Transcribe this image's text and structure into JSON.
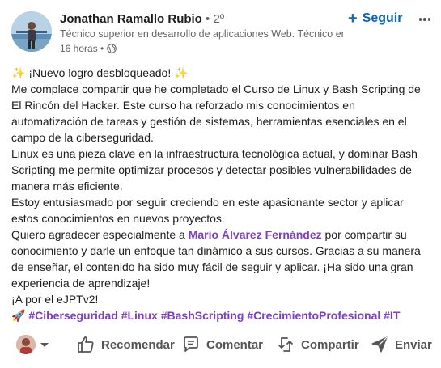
{
  "author": {
    "name": "Jonathan Ramallo Rubio",
    "degree": "• 2º",
    "headline": "Técnico superior en desarrollo de aplicaciones Web. Técnico en s...",
    "time": "16 horas •",
    "follow_label": "Seguir"
  },
  "post": {
    "line1_emoji_left": "✨",
    "line1_text": " ¡Nuevo logro desbloqueado! ",
    "line1_emoji_right": "✨",
    "para1": "Me complace compartir que he completado el Curso de Linux y Bash Scripting de El Rincón del Hacker. Este curso ha reforzado mis conocimientos en automatización de tareas y gestión de sistemas, herramientas esenciales en el campo de la ciberseguridad.",
    "para2": "Linux es una pieza clave en la infraestructura tecnológica actual, y dominar Bash Scripting me permite optimizar procesos y detectar posibles vulnerabilidades de manera más eficiente.",
    "para3": "Estoy entusiasmado por seguir creciendo en este apasionante sector y aplicar estos conocimientos en nuevos proyectos.",
    "para4_before": "Quiero agradecer especialmente a ",
    "para4_mention": "Mario Álvarez Fernández",
    "para4_after": " por compartir su conocimiento y darle un enfoque tan dinámico a sus cursos. Gracias a su manera de enseñar, el contenido ha sido muy fácil de seguir y aplicar. ¡Ha sido una gran experiencia de aprendizaje!",
    "para5": "¡A por el eJPTv2!",
    "rocket_emoji": "🚀",
    "hashtags": [
      "#Ciberseguridad",
      "#Linux",
      "#BashScripting",
      "#CrecimientoProfesional",
      "#IT"
    ]
  },
  "actions": {
    "recomendar": "Recomendar",
    "comentar": "Comentar",
    "compartir": "Compartir",
    "enviar": "Enviar"
  },
  "colors": {
    "link_blue": "#0a66c2",
    "mention_purple": "#7b3fc4",
    "text_dark": "#1d1d1d",
    "text_muted": "#666666"
  }
}
